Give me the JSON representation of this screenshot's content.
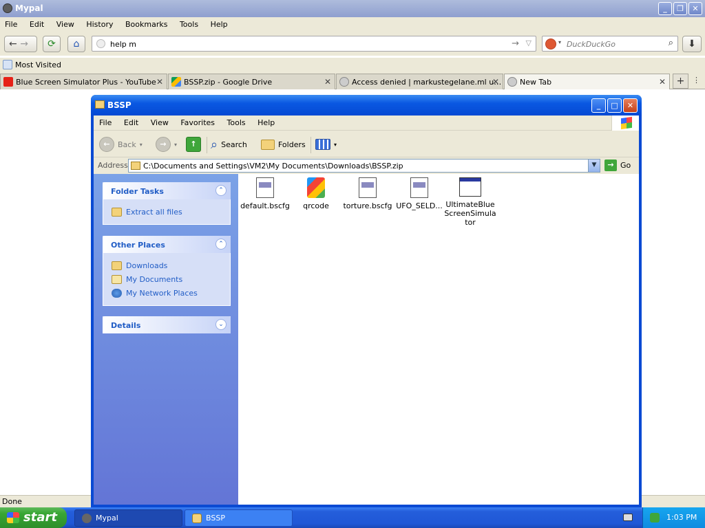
{
  "browser": {
    "title": "Mypal",
    "menu": [
      "File",
      "Edit",
      "View",
      "History",
      "Bookmarks",
      "Tools",
      "Help"
    ],
    "url": "help m",
    "search_placeholder": "DuckDuckGo",
    "bookmark": "Most Visited",
    "tabs": [
      {
        "label": "Blue Screen Simulator Plus - YouTube",
        "icon": "youtube-icon",
        "color": "#e62117"
      },
      {
        "label": "BSSP.zip - Google Drive",
        "icon": "google-drive-icon",
        "color": "#fbbc04"
      },
      {
        "label": "Access denied | markustegelane.ml use...",
        "icon": "globe-icon",
        "color": "#777777"
      },
      {
        "label": "New Tab",
        "icon": "globe-icon",
        "color": "#777777"
      }
    ],
    "status": "Done"
  },
  "explorer": {
    "title": "BSSP",
    "menu": [
      "File",
      "Edit",
      "View",
      "Favorites",
      "Tools",
      "Help"
    ],
    "toolbar": {
      "back": "Back",
      "search": "Search",
      "folders": "Folders"
    },
    "address_label": "Address",
    "address": "C:\\Documents and Settings\\VM2\\My Documents\\Downloads\\BSSP.zip",
    "go": "Go",
    "folder_tasks": {
      "title": "Folder Tasks",
      "items": [
        "Extract all files"
      ]
    },
    "other_places": {
      "title": "Other Places",
      "items": [
        "Downloads",
        "My Documents",
        "My Network Places"
      ]
    },
    "details": {
      "title": "Details"
    },
    "files": [
      {
        "name": "default.bscfg",
        "icon": "config-file-icon"
      },
      {
        "name": "qrcode",
        "icon": "image-file-icon"
      },
      {
        "name": "torture.bscfg",
        "icon": "config-file-icon"
      },
      {
        "name": "UFO_SELD...",
        "icon": "config-file-icon"
      },
      {
        "name": "UltimateBlueScreenSimulator",
        "icon": "application-icon"
      }
    ]
  },
  "taskbar": {
    "start": "start",
    "tasks": [
      "Mypal",
      "BSSP"
    ],
    "clock": "1:03 PM"
  }
}
